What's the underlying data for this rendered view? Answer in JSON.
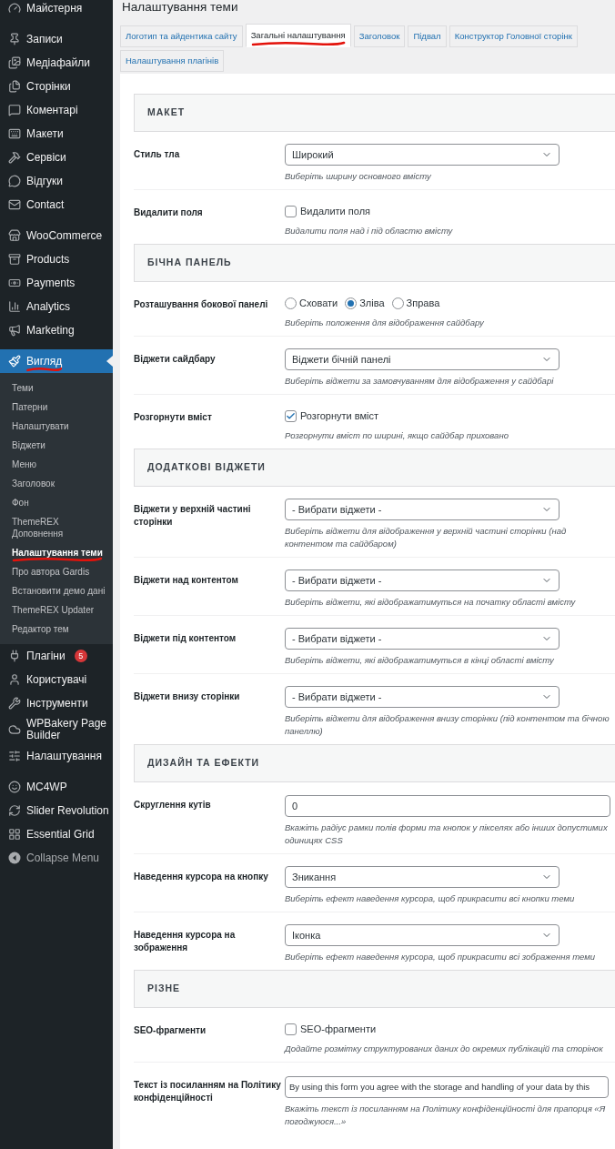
{
  "sidebar": {
    "groups": [
      [
        {
          "label": "Майстерня",
          "selected": false,
          "marked": false
        }
      ],
      [
        {
          "label": "Записи",
          "selected": false,
          "marked": false
        },
        {
          "label": "Медіафайли",
          "selected": false,
          "marked": false
        },
        {
          "label": "Сторінки",
          "selected": false,
          "marked": false
        },
        {
          "label": "Коментарі",
          "selected": false,
          "marked": false
        },
        {
          "label": "Макети",
          "selected": false,
          "marked": false
        },
        {
          "label": "Сервіси",
          "selected": false,
          "marked": false
        },
        {
          "label": "Відгуки",
          "selected": false,
          "marked": false
        },
        {
          "label": "Contact",
          "selected": false,
          "marked": false
        }
      ],
      [
        {
          "label": "WooCommerce",
          "selected": false,
          "marked": false
        },
        {
          "label": "Products",
          "selected": false,
          "marked": false
        },
        {
          "label": "Payments",
          "selected": false,
          "marked": false
        },
        {
          "label": "Analytics",
          "selected": false,
          "marked": false
        },
        {
          "label": "Marketing",
          "selected": false,
          "marked": false
        }
      ],
      [
        {
          "label": "Вигляд",
          "selected": true,
          "marked": true,
          "children": [
            {
              "label": "Теми",
              "selected": false,
              "marked": false
            },
            {
              "label": "Патерни",
              "selected": false,
              "marked": false
            },
            {
              "label": "Налаштувати",
              "selected": false,
              "marked": false
            },
            {
              "label": "Віджети",
              "selected": false,
              "marked": false
            },
            {
              "label": "Меню",
              "selected": false,
              "marked": false
            },
            {
              "label": "Заголовок",
              "selected": false,
              "marked": false
            },
            {
              "label": "Фон",
              "selected": false,
              "marked": false
            },
            {
              "label": "ThemeREX Доповнення",
              "selected": false,
              "marked": false
            },
            {
              "label": "Налаштування теми",
              "selected": true,
              "marked": true
            },
            {
              "label": "Про автора Gardis",
              "selected": false,
              "marked": false
            },
            {
              "label": "Встановити демо дані",
              "selected": false,
              "marked": false
            },
            {
              "label": "ThemeREX Updater",
              "selected": false,
              "marked": false
            },
            {
              "label": "Редактор тем",
              "selected": false,
              "marked": false
            }
          ]
        },
        {
          "label": "Плагіни",
          "selected": false,
          "marked": false,
          "badge": "5"
        },
        {
          "label": "Користувачі",
          "selected": false,
          "marked": false
        },
        {
          "label": "Інструменти",
          "selected": false,
          "marked": false
        },
        {
          "label": "WPBakery Page Builder",
          "selected": false,
          "marked": false
        },
        {
          "label": "Налаштування",
          "selected": false,
          "marked": false
        }
      ],
      [
        {
          "label": "MC4WP",
          "selected": false,
          "marked": false
        },
        {
          "label": "Slider Revolution",
          "selected": false,
          "marked": false
        },
        {
          "label": "Essential Grid",
          "selected": false,
          "marked": false
        },
        {
          "label": "Collapse Menu",
          "selected": false,
          "marked": false,
          "dim": true
        }
      ]
    ]
  },
  "page": {
    "title": "Налаштування теми",
    "tabs": [
      {
        "label": "Логотип та айдентика сайту",
        "selected": false,
        "marked": false
      },
      {
        "label": "Загальні налаштування",
        "selected": true,
        "marked": true
      },
      {
        "label": "Заголовок",
        "selected": false,
        "marked": false
      },
      {
        "label": "Підвал",
        "selected": false,
        "marked": false
      },
      {
        "label": "Конструктор Головної сторінк",
        "selected": false,
        "marked": false
      },
      {
        "label": "Налаштування плагінів",
        "selected": false,
        "marked": false
      }
    ],
    "sections": [
      {
        "title": "МАКЕТ",
        "rows": [
          {
            "label": "Стиль тла",
            "kind": "select",
            "value": "Широкий",
            "description": "Виберіть ширину основного вмісту"
          },
          {
            "label": "Видалити поля",
            "kind": "checkbox",
            "value": "Видалити поля",
            "checked": false,
            "description": "Видалити поля над і під областю вмісту"
          }
        ]
      },
      {
        "title": "БІЧНА ПАНЕЛЬ",
        "rows": [
          {
            "label": "Розташування бокової панелі",
            "kind": "radio",
            "options": [
              {
                "label": "Сховати",
                "selected": false
              },
              {
                "label": "Зліва",
                "selected": true
              },
              {
                "label": "Зправа",
                "selected": false
              }
            ],
            "description": "Виберіть положення для відображення сайдбару"
          },
          {
            "label": "Віджети сайдбару",
            "kind": "select",
            "value": "Віджети бічній панелі",
            "description": "Виберіть віджети за замовчуванням для відображення у сайдбарі"
          },
          {
            "label": "Розгорнути вміст",
            "kind": "checkbox",
            "value": "Розгорнути вміст",
            "checked": true,
            "description": "Розгорнути вміст по ширині, якщо сайдбар приховано"
          }
        ]
      },
      {
        "title": "ДОДАТКОВІ ВІДЖЕТИ",
        "rows": [
          {
            "label": "Віджети у верхній частині сторінки",
            "kind": "select",
            "value": "- Вибрати віджети -",
            "description": "Виберіть віджети для відображення у верхній частині сторінки (над контентом та сайдбаром)"
          },
          {
            "label": "Віджети над контентом",
            "kind": "select",
            "value": "- Вибрати віджети -",
            "description": "Виберіть віджети, які відображатимуться на початку області вмісту"
          },
          {
            "label": "Віджети під контентом",
            "kind": "select",
            "value": "- Вибрати віджети -",
            "description": "Виберіть віджети, які відображатимуться в кінці області вмісту"
          },
          {
            "label": "Віджети внизу сторінки",
            "kind": "select",
            "value": "- Вибрати віджети -",
            "description": "Виберіть віджети для відображення внизу сторінки (під контентом та бічною панеллю)"
          }
        ]
      },
      {
        "title": "ДИЗАЙН ТА ЕФЕКТИ",
        "rows": [
          {
            "label": "Скруглення кутів",
            "kind": "text",
            "value": "0",
            "description": "Вкажіть радіус рамки полів форми та кнопок у пікселях або інших допустимих одиницях CSS"
          },
          {
            "label": "Наведення курсора на кнопку",
            "kind": "select",
            "value": "Зникання",
            "description": "Виберіть ефект наведення курсора, щоб прикрасити всі кнопки теми"
          },
          {
            "label": "Наведення курсора на зображення",
            "kind": "select",
            "value": "Іконка",
            "description": "Виберіть ефект наведення курсора, щоб прикрасити всі зображення теми"
          }
        ]
      },
      {
        "title": "РІЗНЕ",
        "rows": [
          {
            "label": "SEO-фрагменти",
            "kind": "checkbox",
            "value": "SEO-фрагменти",
            "checked": false,
            "description": "Додайте розмітку структурованих даних до окремих публікацій та сторінок"
          },
          {
            "label": "Текст із посиланням на Політику конфіденційності",
            "kind": "longtext",
            "value": "By using this form you agree with the storage and handling of your data by this",
            "description": "Вкажіть текст із посиланням на Політику конфіденційності для прапорця «Я погоджуюся...»"
          }
        ]
      }
    ]
  }
}
